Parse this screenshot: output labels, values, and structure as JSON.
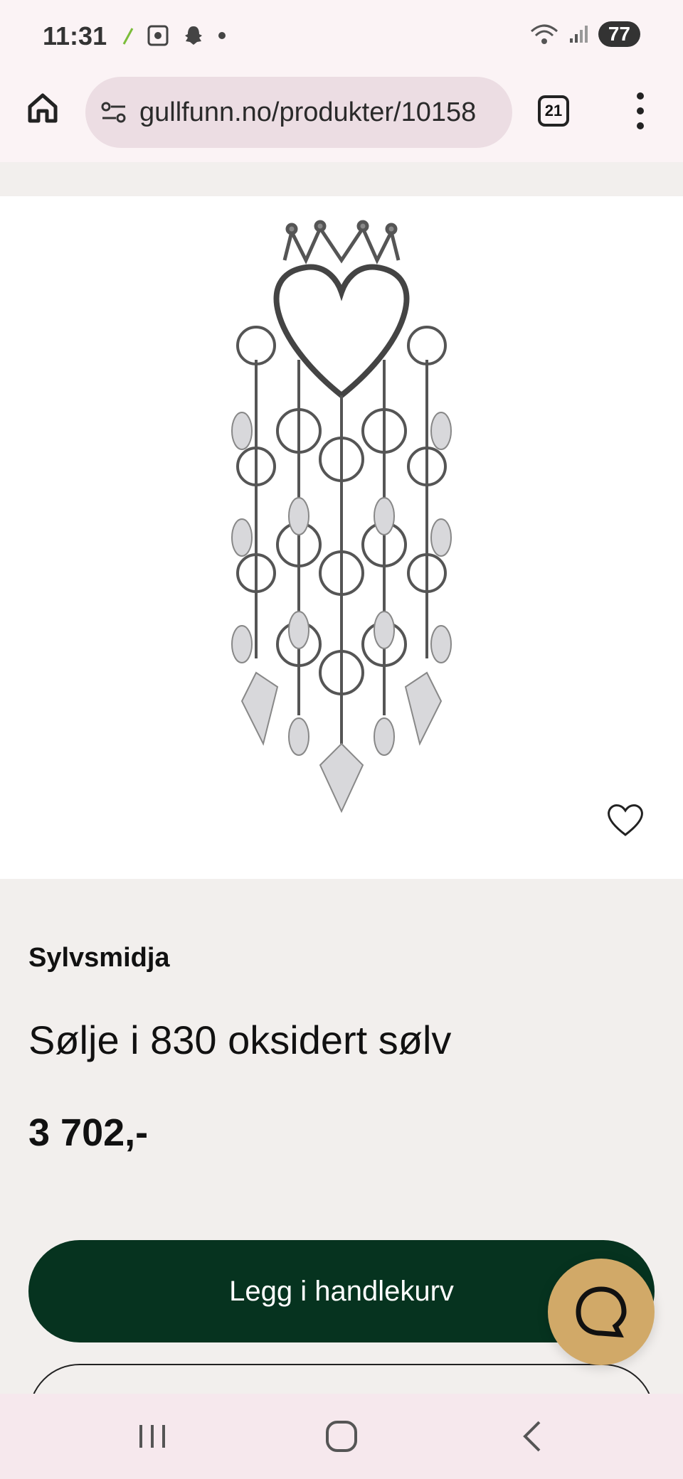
{
  "status": {
    "time": "11:31",
    "battery": "77",
    "network": "5"
  },
  "browser": {
    "url": "gullfunn.no/produkter/10158",
    "tab_count": "21"
  },
  "product": {
    "brand": "Sylvsmidja",
    "title": "Sølje i 830 oksidert sølv",
    "price": "3 702,-",
    "add_to_cart_label": "Legg i handlekurv"
  },
  "icons": {
    "home": "home-icon",
    "site_settings": "tune-icon",
    "menu": "more-vert-icon",
    "wishlist": "heart-icon",
    "chat": "chat-icon",
    "nav_recents": "recents-icon",
    "nav_home": "home-circle-icon",
    "nav_back": "back-icon"
  },
  "colors": {
    "primary_button": "#06331f",
    "chat_button": "#d1a968",
    "page_background": "#f2efed"
  }
}
